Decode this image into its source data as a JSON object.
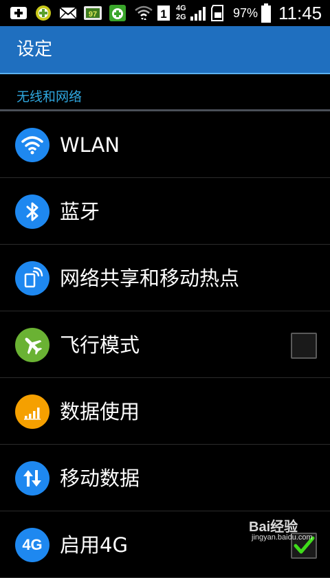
{
  "status_bar": {
    "signal_digit": "1",
    "network_top": "4G",
    "network_bottom": "2G",
    "battery_percent": "97%",
    "time": "11:45",
    "icons": [
      "add-icon",
      "game-app-icon",
      "mail-icon",
      "app-badge-icon",
      "shield-plus-icon",
      "wifi-icon",
      "sim-icon",
      "signal-icon",
      "sd-card-icon",
      "battery-icon"
    ]
  },
  "title_bar": {
    "title": "设定"
  },
  "section": {
    "title": "无线和网络"
  },
  "items": [
    {
      "label": "WLAN",
      "icon": "wifi-icon",
      "color": "#1e88f0"
    },
    {
      "label": "蓝牙",
      "icon": "bluetooth-icon",
      "color": "#1e88f0"
    },
    {
      "label": "网络共享和移动热点",
      "icon": "hotspot-icon",
      "color": "#1e88f0"
    },
    {
      "label": "飞行模式",
      "icon": "airplane-icon",
      "color": "#6ab233",
      "checkbox": false
    },
    {
      "label": "数据使用",
      "icon": "data-usage-icon",
      "color": "#f5a000"
    },
    {
      "label": "移动数据",
      "icon": "mobile-data-icon",
      "color": "#1e88f0"
    },
    {
      "label": "启用4G",
      "icon": "4g-icon",
      "icon_text": "4G",
      "color": "#1e88f0",
      "checkbox": true
    }
  ],
  "watermark": {
    "brand": "Bai经验",
    "url": "jingyan.baidu.com"
  },
  "colors": {
    "title_bar": "#1f6fbf",
    "section_text": "#2fa8e0",
    "check": "#3fdc1a"
  }
}
